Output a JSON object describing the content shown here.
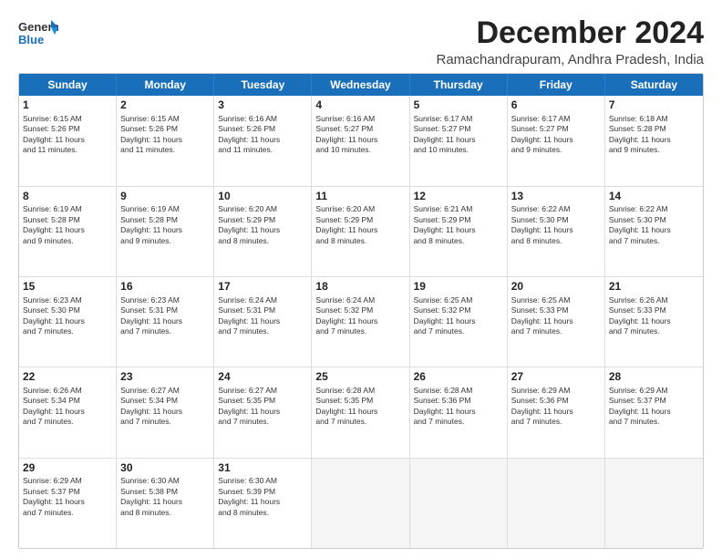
{
  "logo": {
    "line1": "General",
    "line2": "Blue"
  },
  "title": "December 2024",
  "subtitle": "Ramachandrapuram, Andhra Pradesh, India",
  "header_days": [
    "Sunday",
    "Monday",
    "Tuesday",
    "Wednesday",
    "Thursday",
    "Friday",
    "Saturday"
  ],
  "rows": [
    [
      {
        "day": "1",
        "lines": [
          "Sunrise: 6:15 AM",
          "Sunset: 5:26 PM",
          "Daylight: 11 hours",
          "and 11 minutes."
        ]
      },
      {
        "day": "2",
        "lines": [
          "Sunrise: 6:15 AM",
          "Sunset: 5:26 PM",
          "Daylight: 11 hours",
          "and 11 minutes."
        ]
      },
      {
        "day": "3",
        "lines": [
          "Sunrise: 6:16 AM",
          "Sunset: 5:26 PM",
          "Daylight: 11 hours",
          "and 11 minutes."
        ]
      },
      {
        "day": "4",
        "lines": [
          "Sunrise: 6:16 AM",
          "Sunset: 5:27 PM",
          "Daylight: 11 hours",
          "and 10 minutes."
        ]
      },
      {
        "day": "5",
        "lines": [
          "Sunrise: 6:17 AM",
          "Sunset: 5:27 PM",
          "Daylight: 11 hours",
          "and 10 minutes."
        ]
      },
      {
        "day": "6",
        "lines": [
          "Sunrise: 6:17 AM",
          "Sunset: 5:27 PM",
          "Daylight: 11 hours",
          "and 9 minutes."
        ]
      },
      {
        "day": "7",
        "lines": [
          "Sunrise: 6:18 AM",
          "Sunset: 5:28 PM",
          "Daylight: 11 hours",
          "and 9 minutes."
        ]
      }
    ],
    [
      {
        "day": "8",
        "lines": [
          "Sunrise: 6:19 AM",
          "Sunset: 5:28 PM",
          "Daylight: 11 hours",
          "and 9 minutes."
        ]
      },
      {
        "day": "9",
        "lines": [
          "Sunrise: 6:19 AM",
          "Sunset: 5:28 PM",
          "Daylight: 11 hours",
          "and 9 minutes."
        ]
      },
      {
        "day": "10",
        "lines": [
          "Sunrise: 6:20 AM",
          "Sunset: 5:29 PM",
          "Daylight: 11 hours",
          "and 8 minutes."
        ]
      },
      {
        "day": "11",
        "lines": [
          "Sunrise: 6:20 AM",
          "Sunset: 5:29 PM",
          "Daylight: 11 hours",
          "and 8 minutes."
        ]
      },
      {
        "day": "12",
        "lines": [
          "Sunrise: 6:21 AM",
          "Sunset: 5:29 PM",
          "Daylight: 11 hours",
          "and 8 minutes."
        ]
      },
      {
        "day": "13",
        "lines": [
          "Sunrise: 6:22 AM",
          "Sunset: 5:30 PM",
          "Daylight: 11 hours",
          "and 8 minutes."
        ]
      },
      {
        "day": "14",
        "lines": [
          "Sunrise: 6:22 AM",
          "Sunset: 5:30 PM",
          "Daylight: 11 hours",
          "and 7 minutes."
        ]
      }
    ],
    [
      {
        "day": "15",
        "lines": [
          "Sunrise: 6:23 AM",
          "Sunset: 5:30 PM",
          "Daylight: 11 hours",
          "and 7 minutes."
        ]
      },
      {
        "day": "16",
        "lines": [
          "Sunrise: 6:23 AM",
          "Sunset: 5:31 PM",
          "Daylight: 11 hours",
          "and 7 minutes."
        ]
      },
      {
        "day": "17",
        "lines": [
          "Sunrise: 6:24 AM",
          "Sunset: 5:31 PM",
          "Daylight: 11 hours",
          "and 7 minutes."
        ]
      },
      {
        "day": "18",
        "lines": [
          "Sunrise: 6:24 AM",
          "Sunset: 5:32 PM",
          "Daylight: 11 hours",
          "and 7 minutes."
        ]
      },
      {
        "day": "19",
        "lines": [
          "Sunrise: 6:25 AM",
          "Sunset: 5:32 PM",
          "Daylight: 11 hours",
          "and 7 minutes."
        ]
      },
      {
        "day": "20",
        "lines": [
          "Sunrise: 6:25 AM",
          "Sunset: 5:33 PM",
          "Daylight: 11 hours",
          "and 7 minutes."
        ]
      },
      {
        "day": "21",
        "lines": [
          "Sunrise: 6:26 AM",
          "Sunset: 5:33 PM",
          "Daylight: 11 hours",
          "and 7 minutes."
        ]
      }
    ],
    [
      {
        "day": "22",
        "lines": [
          "Sunrise: 6:26 AM",
          "Sunset: 5:34 PM",
          "Daylight: 11 hours",
          "and 7 minutes."
        ]
      },
      {
        "day": "23",
        "lines": [
          "Sunrise: 6:27 AM",
          "Sunset: 5:34 PM",
          "Daylight: 11 hours",
          "and 7 minutes."
        ]
      },
      {
        "day": "24",
        "lines": [
          "Sunrise: 6:27 AM",
          "Sunset: 5:35 PM",
          "Daylight: 11 hours",
          "and 7 minutes."
        ]
      },
      {
        "day": "25",
        "lines": [
          "Sunrise: 6:28 AM",
          "Sunset: 5:35 PM",
          "Daylight: 11 hours",
          "and 7 minutes."
        ]
      },
      {
        "day": "26",
        "lines": [
          "Sunrise: 6:28 AM",
          "Sunset: 5:36 PM",
          "Daylight: 11 hours",
          "and 7 minutes."
        ]
      },
      {
        "day": "27",
        "lines": [
          "Sunrise: 6:29 AM",
          "Sunset: 5:36 PM",
          "Daylight: 11 hours",
          "and 7 minutes."
        ]
      },
      {
        "day": "28",
        "lines": [
          "Sunrise: 6:29 AM",
          "Sunset: 5:37 PM",
          "Daylight: 11 hours",
          "and 7 minutes."
        ]
      }
    ],
    [
      {
        "day": "29",
        "lines": [
          "Sunrise: 6:29 AM",
          "Sunset: 5:37 PM",
          "Daylight: 11 hours",
          "and 7 minutes."
        ]
      },
      {
        "day": "30",
        "lines": [
          "Sunrise: 6:30 AM",
          "Sunset: 5:38 PM",
          "Daylight: 11 hours",
          "and 8 minutes."
        ]
      },
      {
        "day": "31",
        "lines": [
          "Sunrise: 6:30 AM",
          "Sunset: 5:39 PM",
          "Daylight: 11 hours",
          "and 8 minutes."
        ]
      },
      {
        "day": "",
        "lines": []
      },
      {
        "day": "",
        "lines": []
      },
      {
        "day": "",
        "lines": []
      },
      {
        "day": "",
        "lines": []
      }
    ]
  ]
}
